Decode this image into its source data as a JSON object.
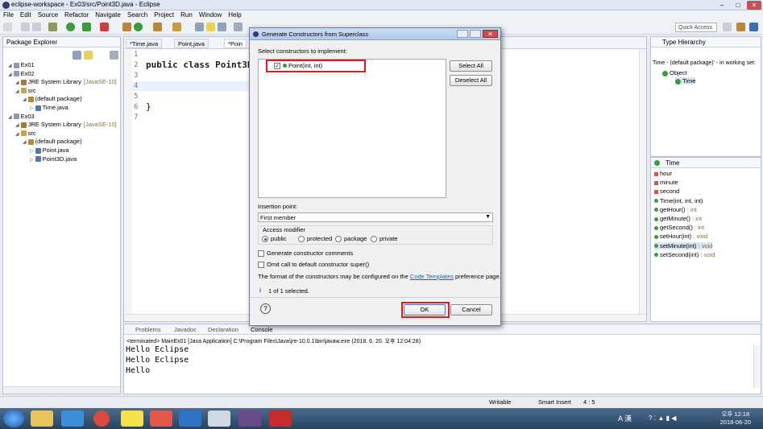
{
  "window": {
    "title": "eclipse-workspace - Ex03/src/Point3D.java - Eclipse",
    "controls": [
      "–",
      "□",
      "✕"
    ]
  },
  "menu": [
    "File",
    "Edit",
    "Source",
    "Refactor",
    "Navigate",
    "Search",
    "Project",
    "Run",
    "Window",
    "Help"
  ],
  "toolbar": {
    "quick_access": "Quick Access"
  },
  "package_explorer": {
    "title": "Package Explorer",
    "tree": [
      {
        "label": "Ex01",
        "indent": 0,
        "kind": "project"
      },
      {
        "label": "Ex02",
        "indent": 0,
        "kind": "project"
      },
      {
        "label": "JRE System Library",
        "suffix": "[JavaSE-10]",
        "indent": 1,
        "kind": "lib"
      },
      {
        "label": "src",
        "indent": 1,
        "kind": "folder"
      },
      {
        "label": "(default package)",
        "indent": 2,
        "kind": "package"
      },
      {
        "label": "Time.java",
        "indent": 3,
        "kind": "file"
      },
      {
        "label": "Ex03",
        "indent": 0,
        "kind": "project"
      },
      {
        "label": "JRE System Library",
        "suffix": "[JavaSE-10]",
        "indent": 1,
        "kind": "lib"
      },
      {
        "label": "src",
        "indent": 1,
        "kind": "folder"
      },
      {
        "label": "(default package)",
        "indent": 2,
        "kind": "package"
      },
      {
        "label": "Point.java",
        "indent": 3,
        "kind": "file"
      },
      {
        "label": "Point3D.java",
        "indent": 3,
        "kind": "file"
      }
    ]
  },
  "editor": {
    "tabs": [
      "*Time.java",
      "Point.java",
      "*Poin"
    ],
    "line_numbers": [
      "1",
      "2",
      "3",
      "4",
      "5",
      "6",
      "7"
    ],
    "code_line2": "public class Point3D e",
    "code_line6": "}"
  },
  "type_hierarchy": {
    "title": "Type Hierarchy",
    "scope": "Time - (default package)' - in working set:",
    "tree": [
      "Object",
      "Time"
    ]
  },
  "members": {
    "title": "Time",
    "items": [
      {
        "name": "hour",
        "type": "",
        "kind": "field"
      },
      {
        "name": "minute",
        "type": "",
        "kind": "field"
      },
      {
        "name": "second",
        "type": "",
        "kind": "field"
      },
      {
        "name": "Time(int, int, int)",
        "type": "",
        "kind": "ctor"
      },
      {
        "name": "getHour()",
        "type": " : int",
        "kind": "method"
      },
      {
        "name": "getMinute()",
        "type": " : int",
        "kind": "method"
      },
      {
        "name": "getSecond()",
        "type": " : int",
        "kind": "method"
      },
      {
        "name": "setHour(int)",
        "type": " : void",
        "kind": "method"
      },
      {
        "name": "setMinute(int)",
        "type": " : void",
        "kind": "method"
      },
      {
        "name": "setSecond(int)",
        "type": " : void",
        "kind": "method"
      }
    ]
  },
  "console": {
    "tabs": [
      "Problems",
      "Javadoc",
      "Declaration",
      "Console"
    ],
    "terminated": "<terminated> MainEx01 [Java Application] C:\\Program Files\\Java\\jre-10.0.1\\bin\\javaw.exe (2018. 6. 20. 오후 12:04:28)",
    "lines": [
      "Hello Eclipse",
      "Hello Eclipse",
      "Hello"
    ]
  },
  "dialog": {
    "title": "Generate Constructors from Superclass",
    "select_label": "Select constructors to implement:",
    "constructor_item": "Point(int, int)",
    "select_all": "Select All",
    "deselect_all": "Deselect All",
    "insertion_label": "Insertion point:",
    "insertion_value": "First member",
    "access_label": "Access modifier",
    "access_options": [
      "public",
      "protected",
      "package",
      "private"
    ],
    "gen_comments": "Generate constructor comments",
    "omit_super": "Omit call to default constructor super()",
    "format_pre": "The format of the constructors may be configured on the ",
    "format_link": "Code Templates",
    "format_post": " preference page.",
    "info": "1 of 1 selected.",
    "ok": "OK",
    "cancel": "Cancel"
  },
  "status": {
    "writable": "Writable",
    "insert": "Smart Insert",
    "position": "4 : 5"
  },
  "taskbar": {
    "lang": "A 漢",
    "time": "오후 12:18",
    "date": "2018-06-20"
  },
  "colors": {
    "highlight_red": "#e11b1b",
    "keyword": "#7f0055",
    "link": "#0563c1"
  }
}
